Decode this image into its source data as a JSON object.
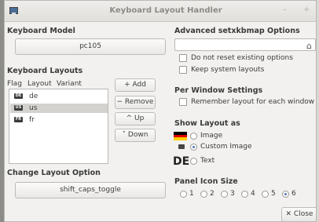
{
  "window": {
    "title": "Keyboard Layout Handler",
    "minimize": "–",
    "close": "+"
  },
  "keyboard_model": {
    "header": "Keyboard Model",
    "value": "pc105"
  },
  "layouts": {
    "header": "Keyboard Layouts",
    "columns": [
      "Flag",
      "Layout",
      "Variant"
    ],
    "rows": [
      {
        "flag": "DE",
        "layout": "de",
        "variant": ""
      },
      {
        "flag": "US",
        "layout": "us",
        "variant": ""
      },
      {
        "flag": "FR",
        "layout": "fr",
        "variant": ""
      }
    ],
    "selected_row": "us",
    "buttons": {
      "add": "+ Add",
      "remove": "− Remove",
      "up": "^ Up",
      "down": "˅ Down"
    }
  },
  "change_option": {
    "header": "Change Layout Option",
    "value": "shift_caps_toggle"
  },
  "advanced": {
    "header": "Advanced setxkbmap Options",
    "input_value": "",
    "do_not_reset": {
      "label": "Do not reset existing options",
      "checked": false
    },
    "keep_system": {
      "label": "Keep system layouts",
      "checked": false
    }
  },
  "per_window": {
    "header": "Per Window Settings",
    "remember": {
      "label": "Remember layout for each window",
      "checked": false
    }
  },
  "show_layout": {
    "header": "Show Layout as",
    "de_text": "DE",
    "options": [
      "Image",
      "Custom Image",
      "Text"
    ],
    "selected": "Custom Image"
  },
  "panel_icon_size": {
    "header": "Panel Icon Size",
    "options": [
      "1",
      "2",
      "3",
      "4",
      "5",
      "6"
    ],
    "selected": "6"
  },
  "footer": {
    "close_label": "✕ Close"
  },
  "colors": {
    "accent": "#5174b5",
    "selection": "#d3d2cf",
    "window_bg": "#f2f1f0"
  }
}
